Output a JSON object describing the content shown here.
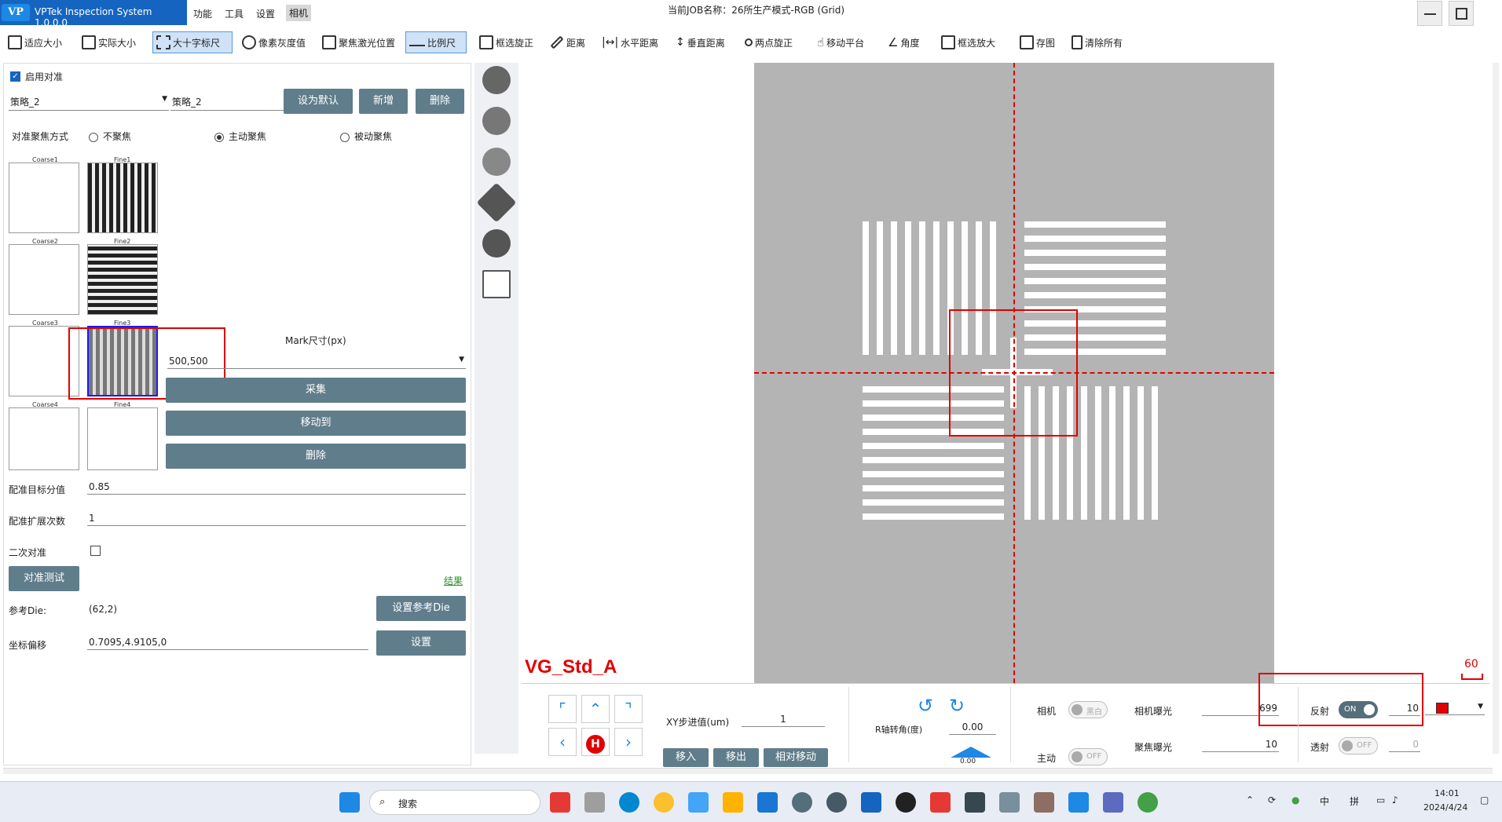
{
  "app": {
    "logo": "VP",
    "title": "VPTek Inspection System 1.0.0.0",
    "menus": [
      "功能",
      "工具",
      "设置",
      "相机"
    ],
    "job_title": "当前JOB名称：26所生产模式-RGB (Grid)"
  },
  "toolbar": {
    "items": [
      "适应大小",
      "实际大小",
      "大十字标尺",
      "像素灰度值",
      "聚焦激光位置",
      "比例尺",
      "框选旋正",
      "距离",
      "水平距离",
      "垂直距离",
      "两点旋正",
      "移动平台",
      "角度",
      "框选放大",
      "存图",
      "清除所有"
    ]
  },
  "left": {
    "enable_align": "启用对准",
    "strategy_select": "策略_2",
    "strategy_name": "策略_2",
    "btn_default": "设为默认",
    "btn_new": "新增",
    "btn_delete_top": "删除",
    "focus_mode_label": "对准聚焦方式",
    "focus_options": [
      "不聚焦",
      "主动聚焦",
      "被动聚焦"
    ],
    "thumbs": [
      {
        "coarse": "Coarse1",
        "fine": "Fine1"
      },
      {
        "coarse": "Coarse2",
        "fine": "Fine2"
      },
      {
        "coarse": "Coarse3",
        "fine": "Fine3"
      },
      {
        "coarse": "Coarse4",
        "fine": "Fine4"
      }
    ],
    "mark_size_label": "Mark尺寸(px)",
    "mark_size_value": "500,500",
    "btn_capture": "采集",
    "btn_move_to": "移动到",
    "btn_delete": "删除",
    "match_score_label": "配准目标分值",
    "match_score_value": "0.85",
    "match_expand_label": "配准扩展次数",
    "match_expand_value": "1",
    "secondary_align_label": "二次对准",
    "btn_align_test": "对准测试",
    "result_link": "结果",
    "ref_die_label": "参考Die:",
    "ref_die_value": "(62,2)",
    "btn_set_ref_die": "设置参考Die",
    "coord_offset_label": "坐标偏移",
    "coord_offset_value": "0.7095,4.9105,0",
    "btn_set": "设置"
  },
  "view": {
    "overlay_label": "VG_Std_A",
    "scale_value": "60"
  },
  "bottom": {
    "xy_step_label": "XY步进值(um)",
    "xy_step_value": "1",
    "btn_move_in": "移入",
    "btn_move_out": "移出",
    "btn_rel_move": "相对移动",
    "home_label": "H",
    "r_angle_label": "R轴转角(度)",
    "r_angle_value": "0.00",
    "r_second_value": "0.00",
    "camera_label": "相机",
    "camera_toggle": "黑白",
    "active_label": "主动",
    "active_toggle": "OFF",
    "cam_exposure_label": "相机曝光",
    "cam_exposure_value": "699",
    "focus_exposure_label": "聚焦曝光",
    "focus_exposure_value": "10",
    "reflect_label": "反射",
    "reflect_toggle": "ON",
    "reflect_value": "10",
    "transmit_label": "透射",
    "transmit_toggle": "OFF",
    "transmit_value": "0",
    "color_swatch": "#e00000"
  },
  "taskbar": {
    "search": "搜索",
    "ime1": "中",
    "ime2": "拼",
    "time": "14:01",
    "date": "2024/4/24"
  },
  "colors": {
    "accent": "#1565C0",
    "button": "#607d8b",
    "overlay_red": "#e00000",
    "link_green": "#2e8b2e"
  }
}
